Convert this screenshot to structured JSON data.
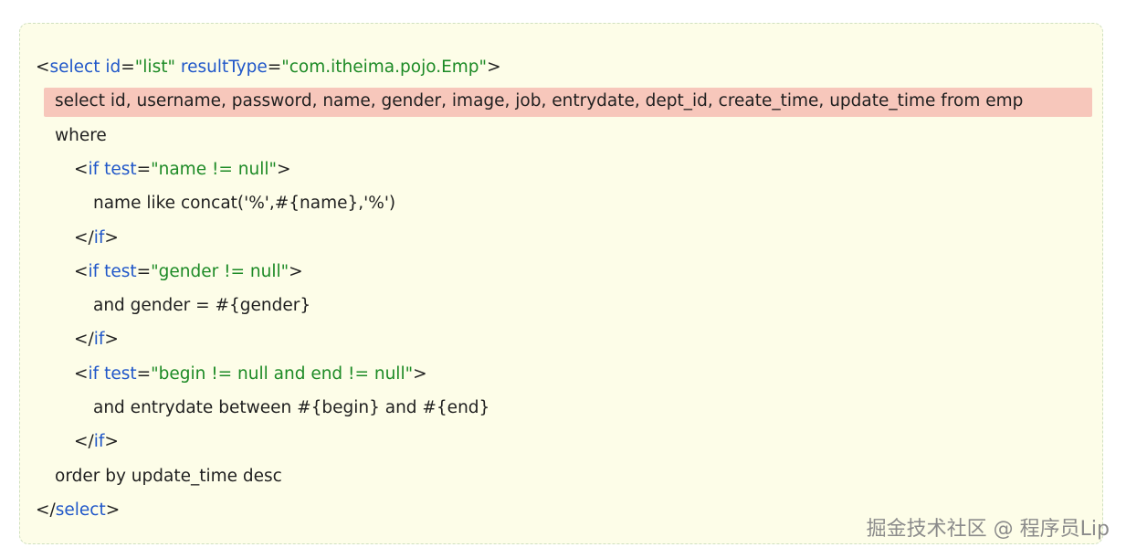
{
  "code": {
    "lines": [
      {
        "indent": 0,
        "tokens": [
          [
            "<",
            "plain"
          ],
          [
            "select",
            "tag"
          ],
          [
            " ",
            "plain"
          ],
          [
            "id",
            "attr"
          ],
          [
            "=",
            "plain"
          ],
          [
            "\"list\"",
            "str"
          ],
          [
            " ",
            "plain"
          ],
          [
            "resultType",
            "attr"
          ],
          [
            "=",
            "plain"
          ],
          [
            "\"com.itheima.pojo.Emp\"",
            "str"
          ],
          [
            ">",
            "plain"
          ]
        ]
      },
      {
        "indent": 1,
        "highlight": true,
        "tokens": [
          [
            "select id, username, password, name, gender, image, job, entrydate, dept_id, create_time, update_time from emp",
            "plain"
          ]
        ]
      },
      {
        "indent": 1,
        "tokens": [
          [
            "where",
            "plain"
          ]
        ]
      },
      {
        "indent": 2,
        "tokens": [
          [
            "<",
            "plain"
          ],
          [
            "if",
            "tag"
          ],
          [
            " ",
            "plain"
          ],
          [
            "test",
            "attr"
          ],
          [
            "=",
            "plain"
          ],
          [
            "\"name != null\"",
            "str"
          ],
          [
            ">",
            "plain"
          ]
        ]
      },
      {
        "indent": 3,
        "tokens": [
          [
            "name like concat('%',#{name},'%')",
            "plain"
          ]
        ]
      },
      {
        "indent": 2,
        "tokens": [
          [
            "</",
            "plain"
          ],
          [
            "if",
            "tag"
          ],
          [
            ">",
            "plain"
          ]
        ]
      },
      {
        "indent": 2,
        "tokens": [
          [
            "<",
            "plain"
          ],
          [
            "if",
            "tag"
          ],
          [
            " ",
            "plain"
          ],
          [
            "test",
            "attr"
          ],
          [
            "=",
            "plain"
          ],
          [
            "\"gender != null\"",
            "str"
          ],
          [
            ">",
            "plain"
          ]
        ]
      },
      {
        "indent": 3,
        "tokens": [
          [
            "and gender = #{gender}",
            "plain"
          ]
        ]
      },
      {
        "indent": 2,
        "tokens": [
          [
            "</",
            "plain"
          ],
          [
            "if",
            "tag"
          ],
          [
            ">",
            "plain"
          ]
        ]
      },
      {
        "indent": 2,
        "tokens": [
          [
            "<",
            "plain"
          ],
          [
            "if",
            "tag"
          ],
          [
            " ",
            "plain"
          ],
          [
            "test",
            "attr"
          ],
          [
            "=",
            "plain"
          ],
          [
            "\"begin != null and end != null\"",
            "str"
          ],
          [
            ">",
            "plain"
          ]
        ]
      },
      {
        "indent": 3,
        "tokens": [
          [
            "and entrydate between #{begin} and #{end}",
            "plain"
          ]
        ]
      },
      {
        "indent": 2,
        "tokens": [
          [
            "</",
            "plain"
          ],
          [
            "if",
            "tag"
          ],
          [
            ">",
            "plain"
          ]
        ]
      },
      {
        "indent": 1,
        "tokens": [
          [
            "order by update_time desc",
            "plain"
          ]
        ]
      },
      {
        "indent": 0,
        "tokens": [
          [
            "</",
            "plain"
          ],
          [
            "select",
            "tag"
          ],
          [
            ">",
            "plain"
          ]
        ]
      }
    ]
  },
  "watermark": "掘金技术社区 @ 程序员Lip",
  "colors": {
    "panel_background": "#fdfde8",
    "highlight": "#f7c7bb",
    "tag": "#2057c9",
    "string": "#1c8a25",
    "text": "#1f1f1f"
  }
}
